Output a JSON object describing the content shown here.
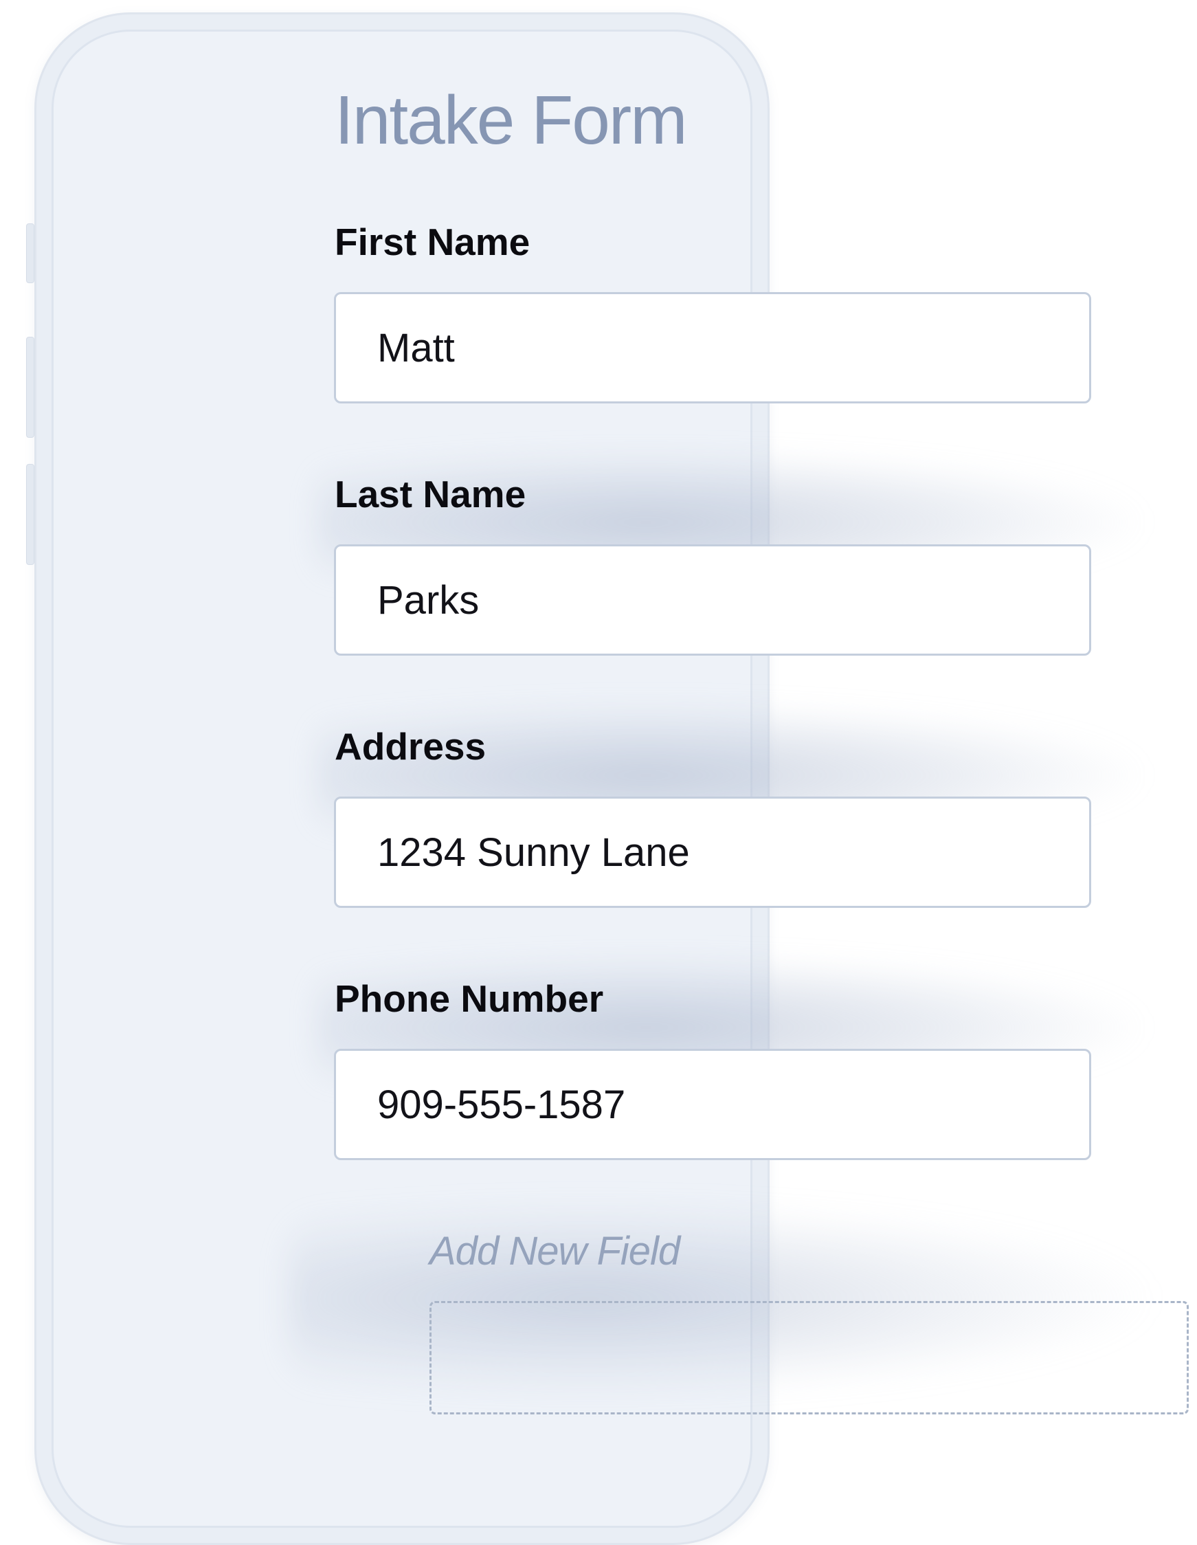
{
  "form": {
    "title": "Intake Form",
    "fields": [
      {
        "label": "First Name",
        "value": "Matt"
      },
      {
        "label": "Last Name",
        "value": "Parks"
      },
      {
        "label": "Address",
        "value": "1234 Sunny Lane"
      },
      {
        "label": "Phone Number",
        "value": "909-555-1587"
      }
    ],
    "add_field_label": "Add New Field"
  }
}
